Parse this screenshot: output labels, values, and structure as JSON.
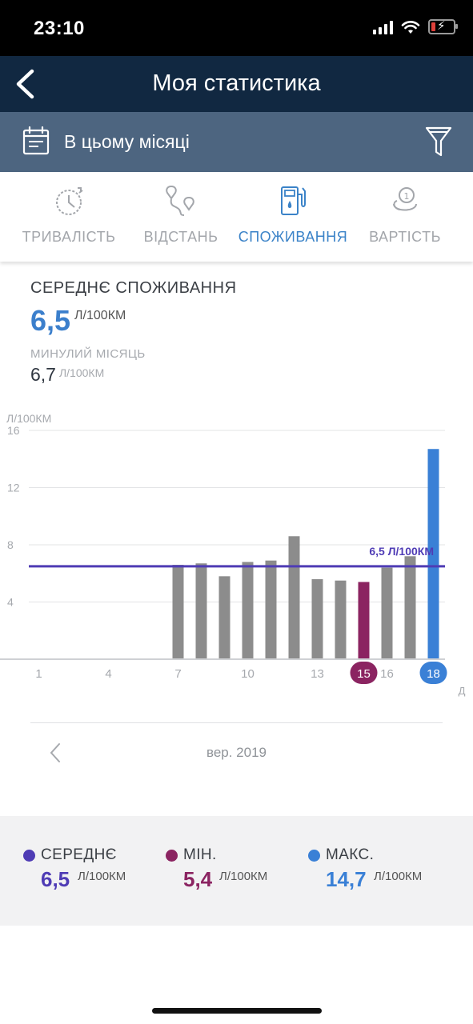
{
  "status_bar": {
    "time": "23:10"
  },
  "header": {
    "title": "Моя статистика"
  },
  "filter": {
    "label": "В цьому місяці"
  },
  "tabs": [
    {
      "label": "ТРИВАЛІСТЬ",
      "icon": "stopwatch-icon",
      "active": false
    },
    {
      "label": "ВІДСТАНЬ",
      "icon": "route-icon",
      "active": false
    },
    {
      "label": "СПОЖИВАННЯ",
      "icon": "fuel-pump-icon",
      "active": true
    },
    {
      "label": "ВАРТІСТЬ",
      "icon": "coins-icon",
      "active": false
    }
  ],
  "summary": {
    "title": "СЕРЕДНЄ СПОЖИВАННЯ",
    "value": "6,5",
    "unit": "Л/100КМ",
    "previous_title": "МИНУЛИЙ МІСЯЦЬ",
    "previous_value": "6,7",
    "previous_unit": "Л/100КМ"
  },
  "chart_data": {
    "type": "bar",
    "ylabel": "Л/100КМ",
    "xlabel": "Д",
    "ylim": [
      0,
      16
    ],
    "yticks": [
      "16",
      "12",
      "8",
      "4"
    ],
    "xticks": [
      "1",
      "4",
      "7",
      "10",
      "13",
      "15",
      "16",
      "18"
    ],
    "x": [
      7,
      8,
      9,
      10,
      11,
      12,
      13,
      14,
      15,
      16,
      17,
      18
    ],
    "values": [
      6.6,
      6.7,
      5.8,
      6.8,
      6.9,
      8.6,
      5.6,
      5.5,
      5.4,
      6.4,
      7.2,
      14.7
    ],
    "highlight_min_day": 15,
    "highlight_max_day": 18,
    "average": 6.5,
    "average_label": "6,5 Л/100КМ",
    "grid": true,
    "colors": {
      "bar": "#8c8c8c",
      "min": "#8b2461",
      "max": "#3a80d6",
      "average": "#4f3cb5"
    }
  },
  "month_nav": {
    "label": "вер. 2019"
  },
  "legend": {
    "average": {
      "label": "СЕРЕДНЄ",
      "value": "6,5",
      "unit": "Л/100КМ",
      "color": "#4f3cb5"
    },
    "min": {
      "label": "МІН.",
      "value": "5,4",
      "unit": "Л/100КМ",
      "color": "#8b2461"
    },
    "max": {
      "label": "МАКС.",
      "value": "14,7",
      "unit": "Л/100КМ",
      "color": "#3a80d6"
    }
  }
}
